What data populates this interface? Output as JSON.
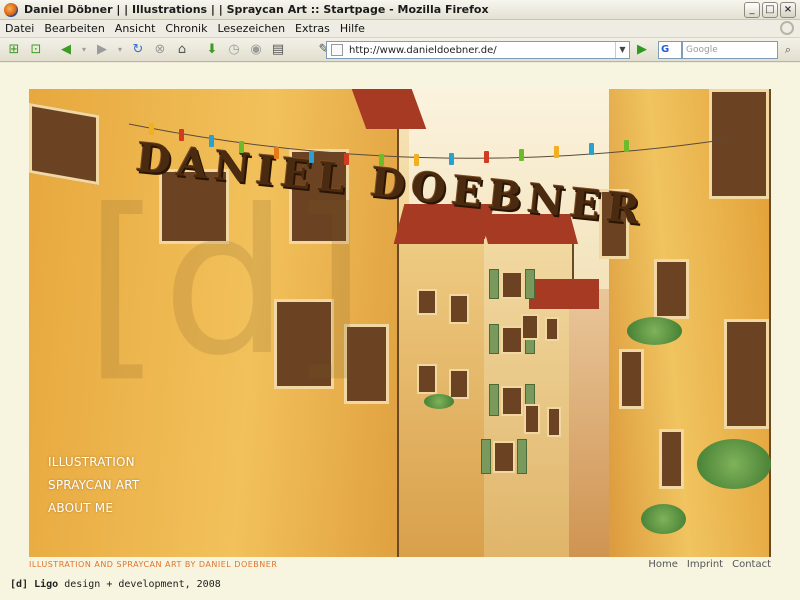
{
  "window": {
    "title": "Daniel Döbner | | Illustrations | | Spraycan Art :: Startpage - Mozilla Firefox"
  },
  "menu": {
    "items": [
      "Datei",
      "Bearbeiten",
      "Ansicht",
      "Chronik",
      "Lesezeichen",
      "Extras",
      "Hilfe"
    ]
  },
  "toolbar": {
    "url": "http://www.danieldoebner.de/",
    "search_engine": "G",
    "search_placeholder": "Google"
  },
  "page": {
    "logo_text": "DANIEL DOEBNER",
    "watermark": "[d]",
    "nav": [
      "ILLUSTRATION",
      "SPRAYCAN ART",
      "ABOUT ME"
    ],
    "tagline": "ILLUSTRATION AND SPRAYCAN ART BY DANIEL DOEBNER",
    "footer_links": [
      "Home",
      "Imprint",
      "Contact"
    ],
    "credit": {
      "mark": "[d] Ligo",
      "text": "design + development, 2008"
    }
  },
  "colors": {
    "page_bg": "#f7f5df",
    "tagline": "#e1742a",
    "logo": "#4a2b10"
  }
}
